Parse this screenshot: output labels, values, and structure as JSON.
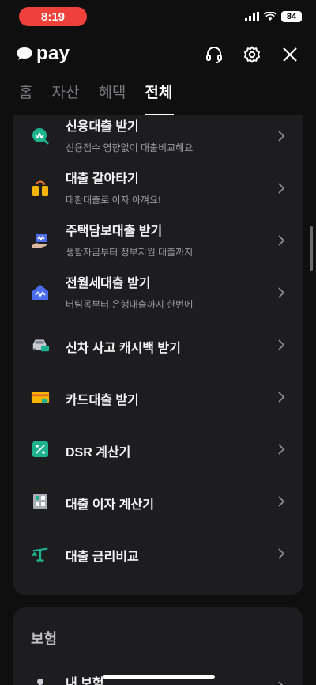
{
  "status_bar": {
    "time": "8:19",
    "battery": "84"
  },
  "header": {
    "logo_text": "pay"
  },
  "tabs": [
    {
      "label": "홈",
      "active": false
    },
    {
      "label": "자산",
      "active": false
    },
    {
      "label": "혜택",
      "active": false
    },
    {
      "label": "전체",
      "active": true
    }
  ],
  "loan_items": [
    {
      "title": "신용대출 받기",
      "subtitle": "신용점수 영향없이 대출비교해요",
      "icon": "credit-loan-icon"
    },
    {
      "title": "대출 갈아타기",
      "subtitle": "대환대출로 이자 아껴요!",
      "icon": "loan-switch-icon"
    },
    {
      "title": "주택담보대출 받기",
      "subtitle": "생활자금부터 정부지원 대출까지",
      "icon": "mortgage-icon"
    },
    {
      "title": "전월세대출 받기",
      "subtitle": "버팀목부터 은행대출까지 한번에",
      "icon": "rent-loan-icon"
    },
    {
      "title": "신차 사고 캐시백 받기",
      "subtitle": "",
      "icon": "car-icon"
    },
    {
      "title": "카드대출 받기",
      "subtitle": "",
      "icon": "card-icon"
    },
    {
      "title": "DSR 계산기",
      "subtitle": "",
      "icon": "percent-icon"
    },
    {
      "title": "대출 이자 계산기",
      "subtitle": "",
      "icon": "calculator-icon"
    },
    {
      "title": "대출 금리비교",
      "subtitle": "",
      "icon": "scale-icon"
    }
  ],
  "insurance": {
    "section_title": "보험",
    "items": [
      {
        "title": "내 보험",
        "icon": "insurance-icon"
      }
    ]
  },
  "colors": {
    "background": "#0f0f10",
    "card": "#1d1d20",
    "time_pill": "#f0403a"
  }
}
